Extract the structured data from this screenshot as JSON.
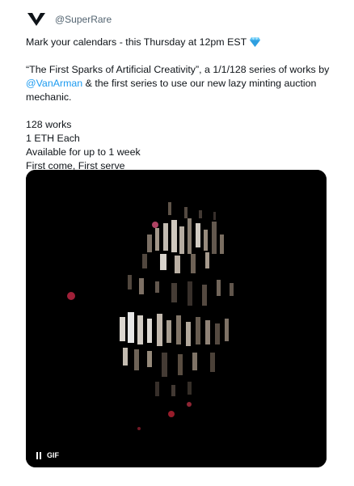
{
  "tweet": {
    "handle": "@SuperRare",
    "line1": "Mark your calendars - this Thursday at 12pm EST",
    "line1_emoji": "gem-icon",
    "quote_title": "“The First Sparks of Artificial Creativity”, a 1/1/128 series of works by",
    "mention": "@VanArman",
    "quote_rest": " & the first series to use our new lazy minting auction mechanic.",
    "details": [
      "128 works",
      "1 ETH Each",
      "Available for up to 1 week",
      "First come, First serve"
    ]
  },
  "media": {
    "badge_label": "GIF",
    "badge_icon": "pause-icon"
  },
  "colors": {
    "link": "#1d9bf0",
    "muted": "#536471",
    "media_bg": "#000000"
  }
}
